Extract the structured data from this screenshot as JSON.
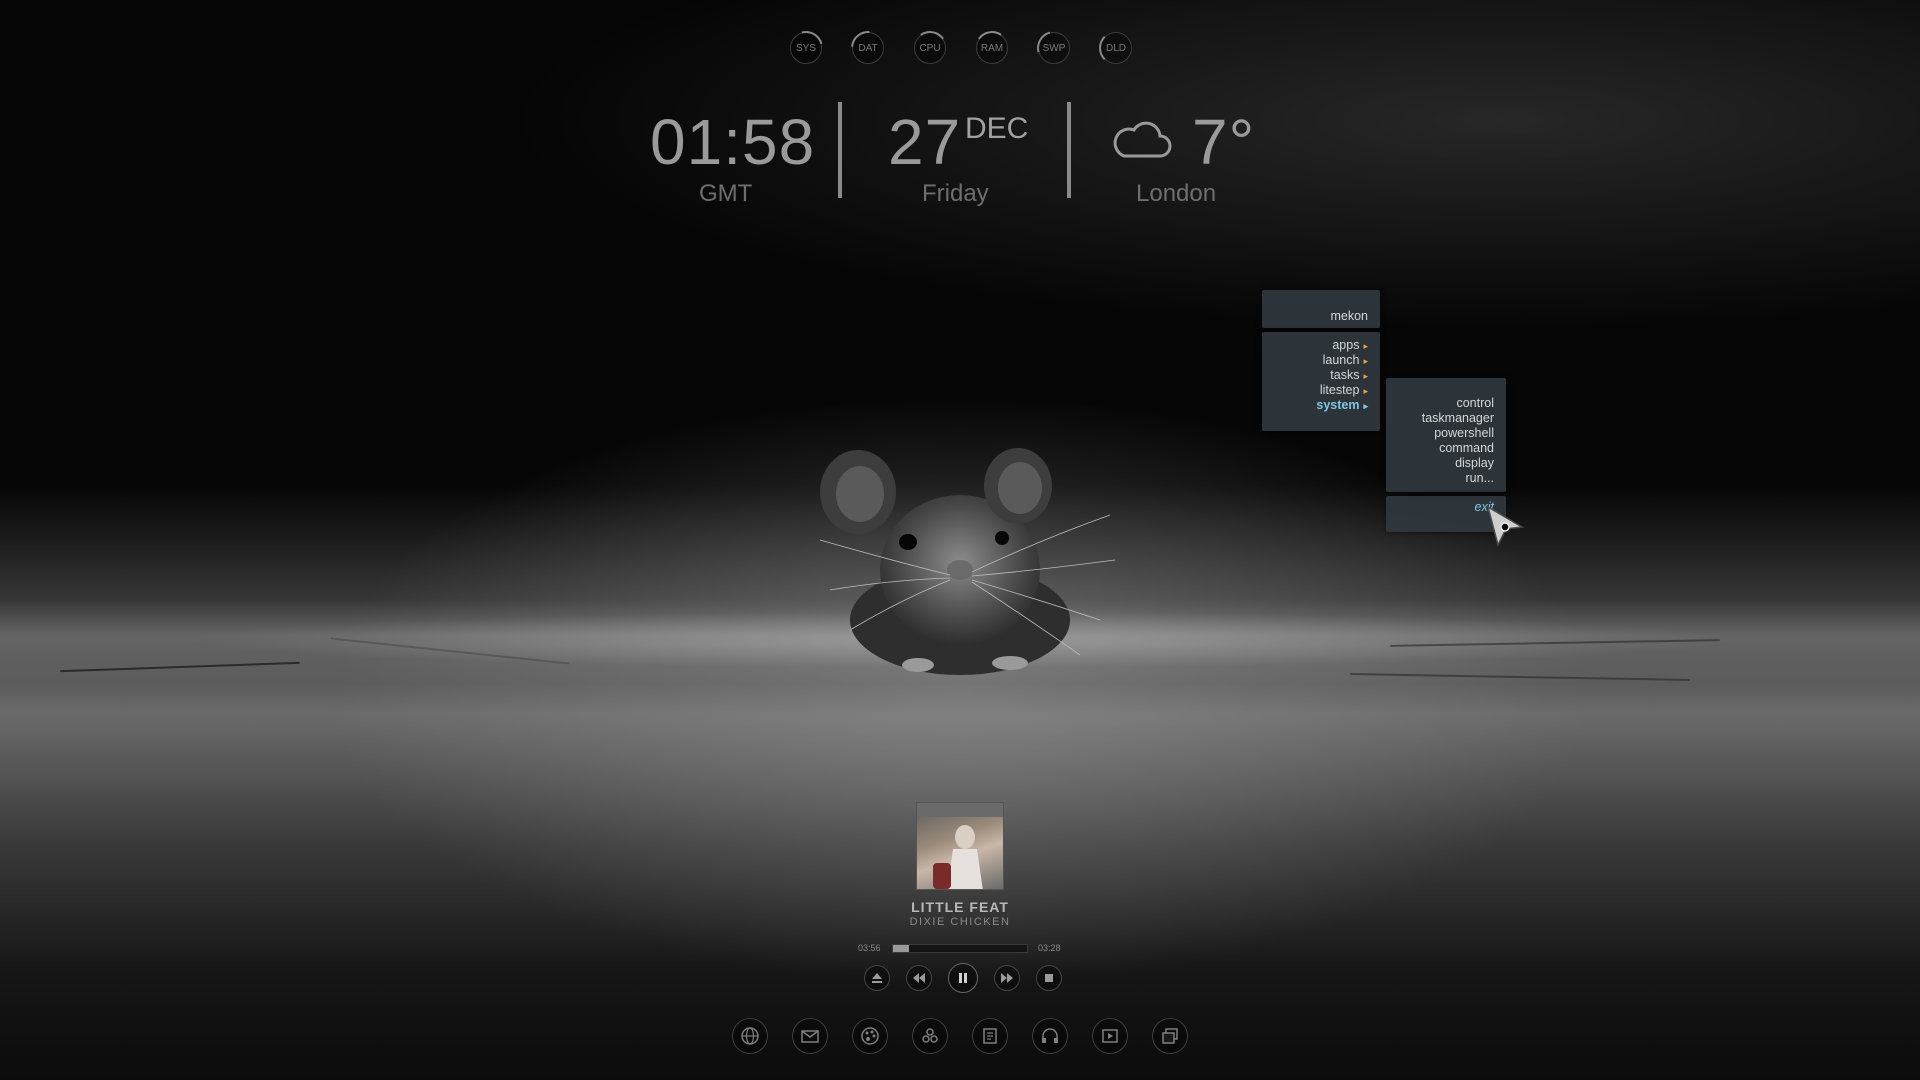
{
  "meters": [
    {
      "label": "SYS",
      "icon": "sys-meter-icon"
    },
    {
      "label": "DAT",
      "icon": "dat-meter-icon"
    },
    {
      "label": "CPU",
      "icon": "cpu-meter-icon"
    },
    {
      "label": "RAM",
      "icon": "ram-meter-icon"
    },
    {
      "label": "SWP",
      "icon": "swp-meter-icon"
    },
    {
      "label": "DLD",
      "icon": "dld-meter-icon"
    }
  ],
  "clock": {
    "time": "01:58",
    "zone": "GMT"
  },
  "date": {
    "day": "27",
    "month": "DEC",
    "weekday": "Friday"
  },
  "weather": {
    "temp": "7°",
    "city": "London",
    "icon": "cloud-icon"
  },
  "menu": {
    "header": "mekon",
    "items": [
      {
        "label": "apps",
        "arrow": "▸"
      },
      {
        "label": "launch",
        "arrow": "▸"
      },
      {
        "label": "tasks",
        "arrow": "▸"
      },
      {
        "label": "litestep",
        "arrow": "▸"
      },
      {
        "label": "system",
        "arrow": "▸"
      }
    ],
    "submenu": [
      "control",
      "taskmanager",
      "powershell",
      "command",
      "display",
      "run..."
    ],
    "exit": "exit"
  },
  "player": {
    "artist": "LITTLE FEAT",
    "track": "DIXIE CHICKEN",
    "elapsed": "03:56",
    "total": "03:28",
    "progress": 0.12
  },
  "dock": [
    "globe-icon",
    "mail-icon",
    "palette-icon",
    "network-icon",
    "notes-icon",
    "headphones-icon",
    "media-icon",
    "windows-icon"
  ]
}
